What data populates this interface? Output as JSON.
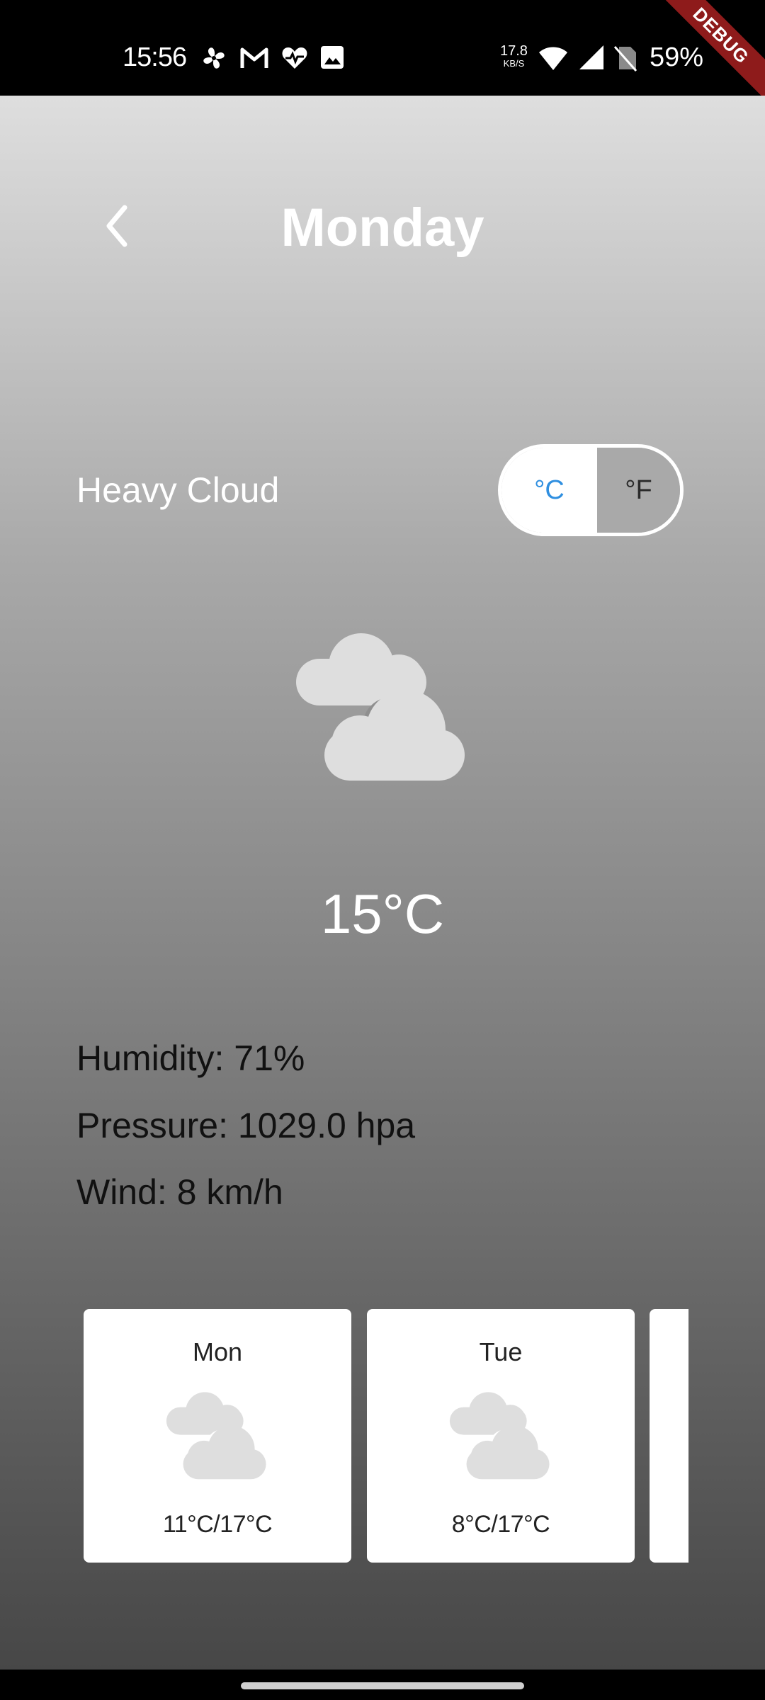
{
  "status_bar": {
    "time": "15:56",
    "net_speed_value": "17.8",
    "net_speed_unit": "KB/S",
    "battery": "59%",
    "debug_banner": "DEBUG"
  },
  "header": {
    "title": "Monday",
    "back_icon": "chevron-left-icon"
  },
  "weather": {
    "condition": "Heavy Cloud",
    "icon": "heavy-cloud-icon",
    "temperature": "15°C",
    "unit_toggle": {
      "celsius_label": "°C",
      "fahrenheit_label": "°F",
      "selected": "°C",
      "selected_color": "#2f8fe0"
    },
    "humidity": "Humidity: 71%",
    "pressure": "Pressure: 1029.0 hpa",
    "wind": "Wind: 8 km/h"
  },
  "forecast": [
    {
      "day": "Mon",
      "range": "11°C/17°C",
      "icon": "heavy-cloud-icon"
    },
    {
      "day": "Tue",
      "range": "8°C/17°C",
      "icon": "heavy-cloud-icon"
    }
  ]
}
